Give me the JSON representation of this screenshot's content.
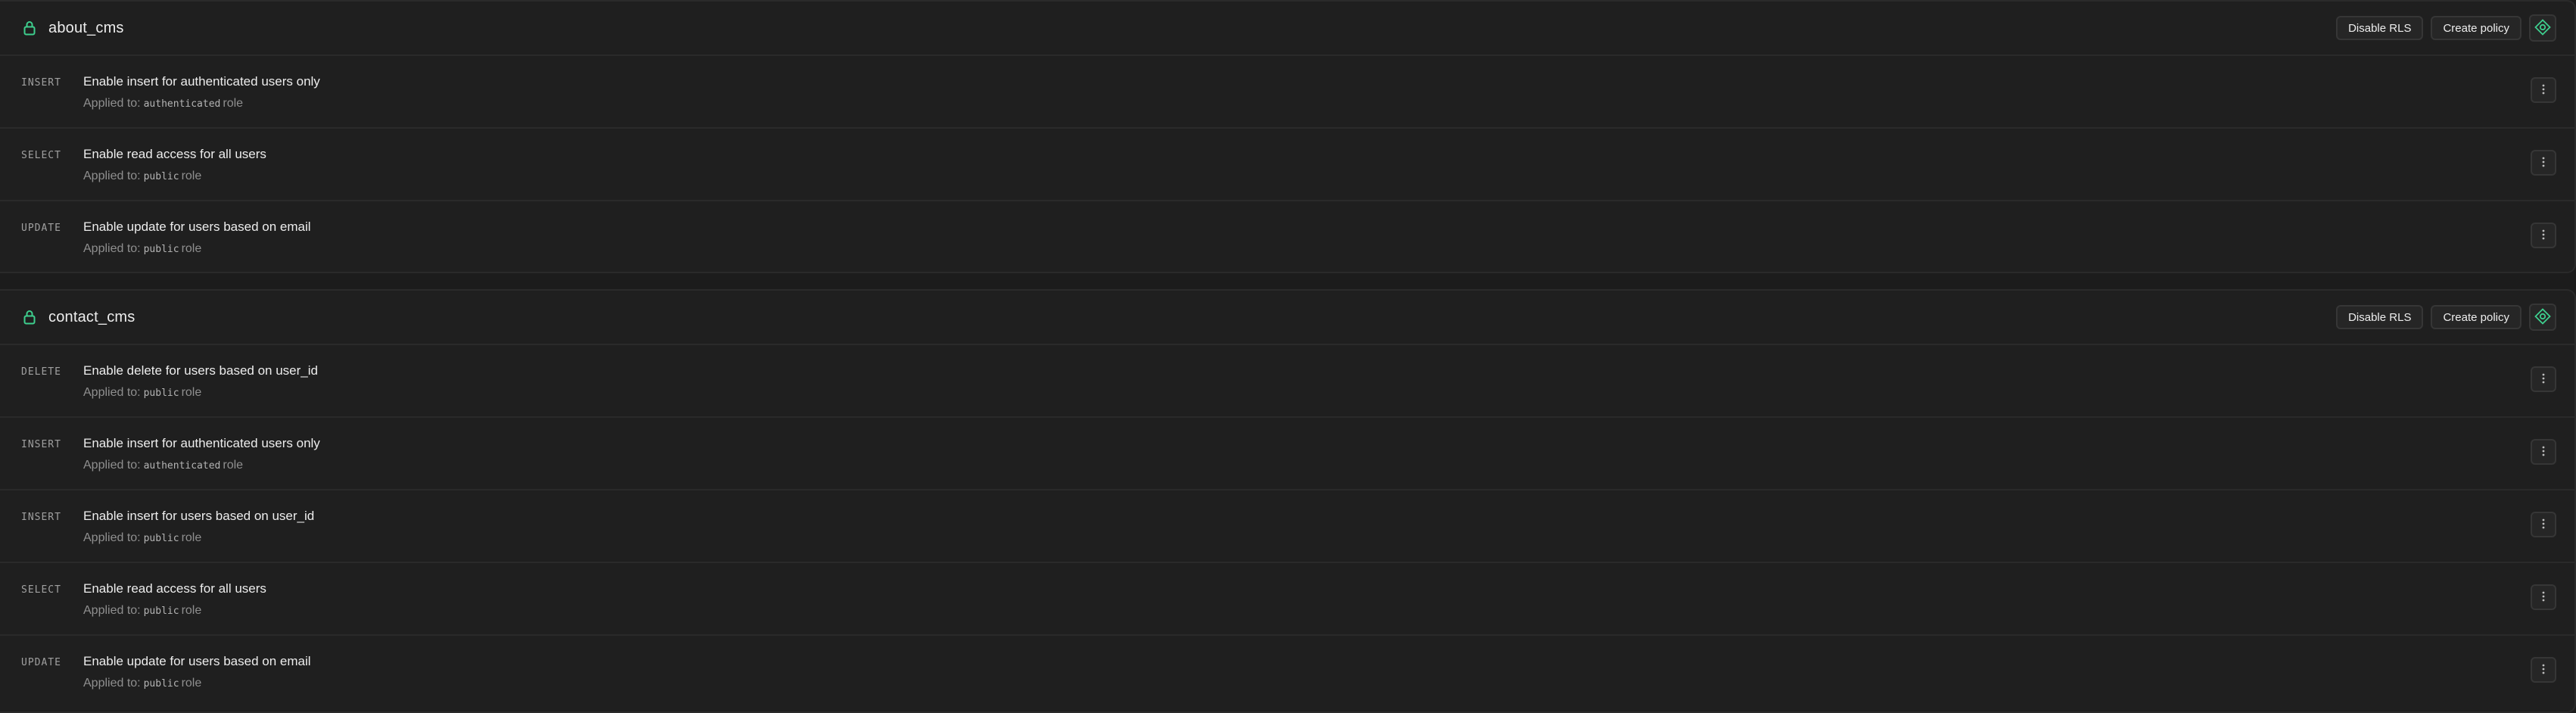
{
  "colors": {
    "accent": "#3ecf8e",
    "background": "#1c1c1c",
    "panel": "#1f1f1f",
    "border": "#2a2a2a"
  },
  "tables": [
    {
      "name": "about_cms",
      "lock_icon": "lock-icon",
      "disable_rls_label": "Disable RLS",
      "create_policy_label": "Create policy",
      "ai_icon": "ai-assistant-icon",
      "policies": [
        {
          "command": "INSERT",
          "name": "Enable insert for authenticated users only",
          "applied_prefix": "Applied to:",
          "role": "authenticated",
          "role_suffix": "role"
        },
        {
          "command": "SELECT",
          "name": "Enable read access for all users",
          "applied_prefix": "Applied to:",
          "role": "public",
          "role_suffix": "role"
        },
        {
          "command": "UPDATE",
          "name": "Enable update for users based on email",
          "applied_prefix": "Applied to:",
          "role": "public",
          "role_suffix": "role"
        }
      ]
    },
    {
      "name": "contact_cms",
      "lock_icon": "lock-icon",
      "disable_rls_label": "Disable RLS",
      "create_policy_label": "Create policy",
      "ai_icon": "ai-assistant-icon",
      "policies": [
        {
          "command": "DELETE",
          "name": "Enable delete for users based on user_id",
          "applied_prefix": "Applied to:",
          "role": "public",
          "role_suffix": "role"
        },
        {
          "command": "INSERT",
          "name": "Enable insert for authenticated users only",
          "applied_prefix": "Applied to:",
          "role": "authenticated",
          "role_suffix": "role"
        },
        {
          "command": "INSERT",
          "name": "Enable insert for users based on user_id",
          "applied_prefix": "Applied to:",
          "role": "public",
          "role_suffix": "role"
        },
        {
          "command": "SELECT",
          "name": "Enable read access for all users",
          "applied_prefix": "Applied to:",
          "role": "public",
          "role_suffix": "role"
        },
        {
          "command": "UPDATE",
          "name": "Enable update for users based on email",
          "applied_prefix": "Applied to:",
          "role": "public",
          "role_suffix": "role"
        }
      ]
    }
  ]
}
